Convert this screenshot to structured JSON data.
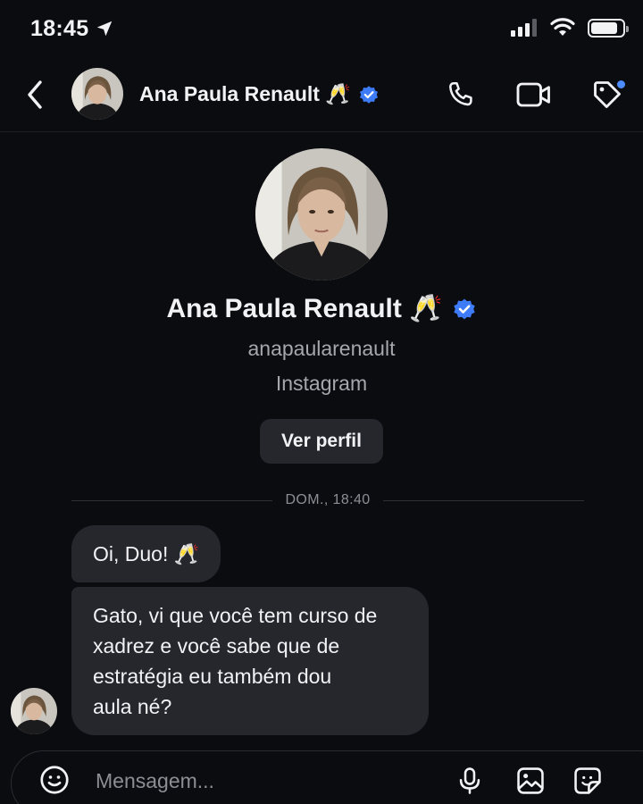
{
  "status_bar": {
    "time": "18:45",
    "icons": [
      "location-arrow-icon",
      "signal-bars-icon",
      "wifi-icon",
      "battery-icon"
    ],
    "battery_level": 0.85
  },
  "header": {
    "name": "Ana Paula Renault 🥂",
    "verified": true,
    "icons": [
      "back-chevron-icon",
      "phone-icon",
      "video-camera-icon",
      "tag-icon"
    ]
  },
  "profile": {
    "name": "Ana Paula Renault 🥂",
    "handle": "anapaularenault",
    "source": "Instagram",
    "view_profile_label": "Ver perfil"
  },
  "conversation": {
    "date_label": "DOM., 18:40",
    "messages": [
      {
        "text": "Oi, Duo! 🥂"
      },
      {
        "text": "Gato, vi que você tem curso de\nxadrez e você sabe que de\nestratégia eu também dou\naula né?"
      }
    ]
  },
  "composer": {
    "placeholder": "Mensagem...",
    "icons": [
      "emoji-icon",
      "microphone-icon",
      "gallery-icon",
      "sticker-icon"
    ]
  },
  "colors": {
    "background": "#0b0c10",
    "bubble": "#26272d",
    "verified_blue": "#3d7bf7",
    "secondary_text": "#a6a7ad"
  }
}
